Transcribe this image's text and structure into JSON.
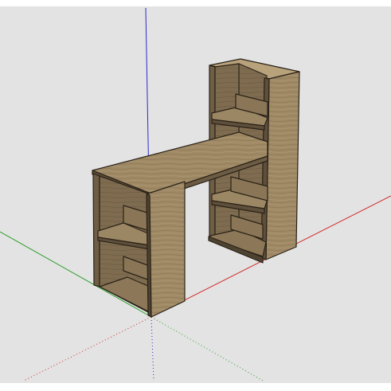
{
  "viewport": {
    "background_color": "#e3e3e3",
    "page_color": "#ffffff"
  },
  "axes": {
    "red_color": "#d22b2b",
    "green_color": "#2a9d2a",
    "blue_color": "#2b2bd2"
  },
  "model": {
    "name_icon": "desk-with-bookshelf-model",
    "wood_light": "#a99470",
    "wood_mid": "#8a7656",
    "wood_dark": "#6a5a42",
    "edge_color": "#2a2218"
  }
}
